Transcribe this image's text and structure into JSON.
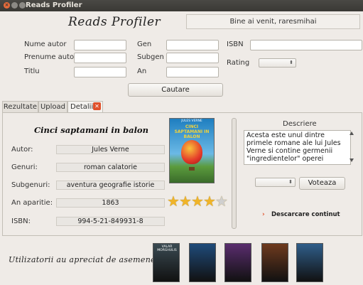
{
  "window": {
    "title": "Reads Profiler"
  },
  "header": {
    "logo": "Reads Profiler",
    "welcome": "Bine ai venit, raresmihai"
  },
  "search": {
    "fields": {
      "nume_autor": {
        "label": "Nume autor",
        "value": ""
      },
      "prenume_autor": {
        "label": "Prenume autor",
        "value": ""
      },
      "titlu": {
        "label": "Titlu",
        "value": ""
      },
      "gen": {
        "label": "Gen",
        "value": ""
      },
      "subgen": {
        "label": "Subgen",
        "value": ""
      },
      "an": {
        "label": "An",
        "value": ""
      },
      "isbn": {
        "label": "ISBN",
        "value": ""
      },
      "rating": {
        "label": "Rating",
        "value": ""
      }
    },
    "button_label": "Cautare"
  },
  "tabs": [
    {
      "label": "Rezultate"
    },
    {
      "label": "Upload"
    },
    {
      "label": "Detalii",
      "active": true,
      "close_label": "✕"
    }
  ],
  "details": {
    "title": "Cinci saptamani in balon",
    "fields": [
      {
        "label": "Autor:",
        "value": "Jules Verne"
      },
      {
        "label": "Genuri:",
        "value": "roman calatorie"
      },
      {
        "label": "Subgenuri:",
        "value": "aventura geografie istorie"
      },
      {
        "label": "An aparitie:",
        "value": "1863"
      },
      {
        "label": "ISBN:",
        "value": "994-5-21-849931-8"
      }
    ],
    "cover": {
      "author": "JULES VERNE",
      "title": "CINCI SAPTAMANI IN BALON"
    },
    "rating": {
      "value": 4,
      "max": 5,
      "filled_color": "#f0b429",
      "empty_color": "#cfcfcf"
    },
    "description_label": "Descriere",
    "description": "Acesta este unul dintre primele romane ale lui Jules Verne si contine germenii \"ingredientelor\" operei",
    "vote_select_value": "",
    "vote_button": "Voteaza",
    "download_link": "Descarcare continut"
  },
  "recommendations": {
    "label": "Utilizatorii au apreciat de asemenea:",
    "books": [
      {
        "title": "VALAR MORGHULIS",
        "color": "#3a4a52"
      },
      {
        "title": "",
        "color": "#1f4b7a"
      },
      {
        "title": "",
        "color": "#5a2d6e"
      },
      {
        "title": "",
        "color": "#6e3a1e"
      },
      {
        "title": "",
        "color": "#2f5e8a"
      }
    ]
  },
  "colors": {
    "accent_orange": "#e0502a",
    "titlebar": "#3c3b37",
    "star": "#f0b429"
  }
}
